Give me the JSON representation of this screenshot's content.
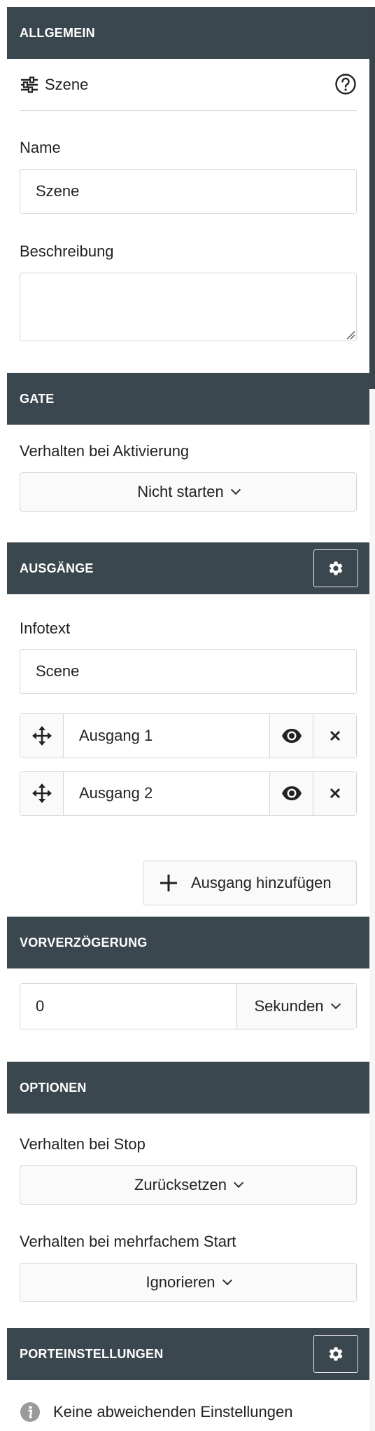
{
  "allgemein": {
    "header": "ALLGEMEIN",
    "scene_title": "Szene",
    "name_label": "Name",
    "name_value": "Szene",
    "description_label": "Beschreibung",
    "description_value": ""
  },
  "gate": {
    "header": "GATE",
    "activation_label": "Verhalten bei Aktivierung",
    "activation_value": "Nicht starten"
  },
  "ausgaenge": {
    "header": "AUSGÄNGE",
    "infotext_label": "Infotext",
    "infotext_value": "Scene",
    "outputs": [
      {
        "label": "Ausgang 1"
      },
      {
        "label": "Ausgang 2"
      }
    ],
    "add_label": "Ausgang hinzufügen"
  },
  "vorverzoegerung": {
    "header": "VORVERZÖGERUNG",
    "value": "0",
    "unit": "Sekunden"
  },
  "optionen": {
    "header": "OPTIONEN",
    "stop_label": "Verhalten bei Stop",
    "stop_value": "Zurücksetzen",
    "multistart_label": "Verhalten bei mehrfachem Start",
    "multistart_value": "Ignorieren"
  },
  "porteinstellungen": {
    "header": "PORTEINSTELLUNGEN",
    "info_text": "Keine abweichenden Einstellungen"
  },
  "colors": {
    "header_bg": "#3b474e",
    "border": "#d6d6d6",
    "info_icon": "#9a9a9a"
  },
  "icons": [
    "sliders-icon",
    "help-circle-icon",
    "gear-icon",
    "move-icon",
    "eye-icon",
    "close-icon",
    "plus-icon",
    "chevron-down-icon",
    "info-icon"
  ]
}
